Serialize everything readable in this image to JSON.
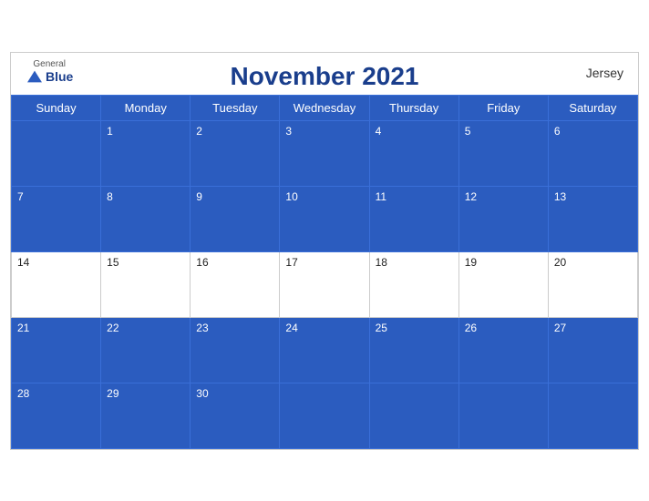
{
  "header": {
    "brand_general": "General",
    "brand_blue": "Blue",
    "title": "November 2021",
    "region": "Jersey"
  },
  "weekdays": [
    "Sunday",
    "Monday",
    "Tuesday",
    "Wednesday",
    "Thursday",
    "Friday",
    "Saturday"
  ],
  "weeks": [
    [
      {
        "day": "",
        "blue": true
      },
      {
        "day": "1",
        "blue": true
      },
      {
        "day": "2",
        "blue": true
      },
      {
        "day": "3",
        "blue": true
      },
      {
        "day": "4",
        "blue": true
      },
      {
        "day": "5",
        "blue": true
      },
      {
        "day": "6",
        "blue": true
      }
    ],
    [
      {
        "day": "7",
        "blue": true
      },
      {
        "day": "8",
        "blue": true
      },
      {
        "day": "9",
        "blue": true
      },
      {
        "day": "10",
        "blue": true
      },
      {
        "day": "11",
        "blue": true
      },
      {
        "day": "12",
        "blue": true
      },
      {
        "day": "13",
        "blue": true
      }
    ],
    [
      {
        "day": "14",
        "blue": false
      },
      {
        "day": "15",
        "blue": false
      },
      {
        "day": "16",
        "blue": false
      },
      {
        "day": "17",
        "blue": false
      },
      {
        "day": "18",
        "blue": false
      },
      {
        "day": "19",
        "blue": false
      },
      {
        "day": "20",
        "blue": false
      }
    ],
    [
      {
        "day": "21",
        "blue": true
      },
      {
        "day": "22",
        "blue": true
      },
      {
        "day": "23",
        "blue": true
      },
      {
        "day": "24",
        "blue": true
      },
      {
        "day": "25",
        "blue": true
      },
      {
        "day": "26",
        "blue": true
      },
      {
        "day": "27",
        "blue": true
      }
    ],
    [
      {
        "day": "28",
        "blue": true
      },
      {
        "day": "29",
        "blue": true
      },
      {
        "day": "30",
        "blue": true
      },
      {
        "day": "",
        "blue": true
      },
      {
        "day": "",
        "blue": true
      },
      {
        "day": "",
        "blue": true
      },
      {
        "day": "",
        "blue": true
      }
    ]
  ]
}
